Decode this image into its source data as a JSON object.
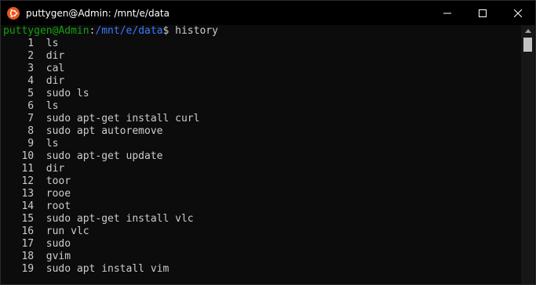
{
  "window": {
    "title": "puttygen@Admin: /mnt/e/data",
    "icon": "ubuntu-icon",
    "controls": [
      "minimize",
      "maximize",
      "close"
    ]
  },
  "terminal": {
    "prompt": {
      "user_host": "puttygen@Admin",
      "colon": ":",
      "path": "/mnt/e/data",
      "symbol": "$",
      "command": " history"
    },
    "history": [
      {
        "num": "1",
        "cmd": "ls"
      },
      {
        "num": "2",
        "cmd": "dir"
      },
      {
        "num": "3",
        "cmd": "cal"
      },
      {
        "num": "4",
        "cmd": "dir"
      },
      {
        "num": "5",
        "cmd": "sudo ls"
      },
      {
        "num": "6",
        "cmd": "ls"
      },
      {
        "num": "7",
        "cmd": "sudo apt-get install curl"
      },
      {
        "num": "8",
        "cmd": "sudo apt autoremove"
      },
      {
        "num": "9",
        "cmd": "ls"
      },
      {
        "num": "10",
        "cmd": "sudo apt-get update"
      },
      {
        "num": "11",
        "cmd": "dir"
      },
      {
        "num": "12",
        "cmd": "toor"
      },
      {
        "num": "13",
        "cmd": "rooe"
      },
      {
        "num": "14",
        "cmd": "root"
      },
      {
        "num": "15",
        "cmd": "sudo apt-get install vlc"
      },
      {
        "num": "16",
        "cmd": "run vlc"
      },
      {
        "num": "17",
        "cmd": "sudo"
      },
      {
        "num": "18",
        "cmd": "gvim"
      },
      {
        "num": "19",
        "cmd": "sudo apt install vim"
      }
    ]
  },
  "colors": {
    "background": "#0c0c0c",
    "text": "#cccccc",
    "prompt_user": "#13a10e",
    "prompt_path": "#3b78ff",
    "ubuntu_orange": "#e95420"
  }
}
